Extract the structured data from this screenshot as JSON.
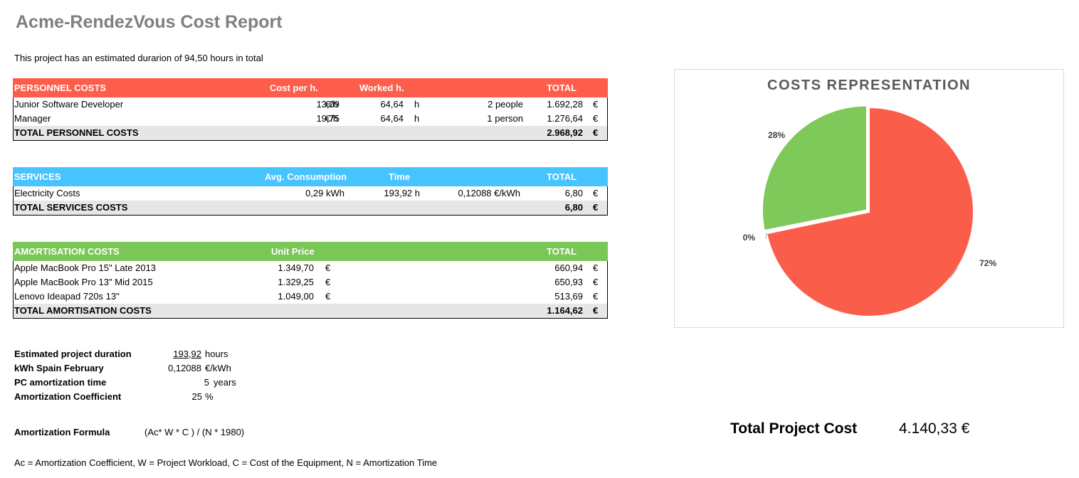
{
  "report": {
    "title": "Acme-RendezVous Cost Report",
    "intro": "This project has an estimated durarion of 94,50 hours in total"
  },
  "colors": {
    "personnel": "#ff5d4b",
    "services": "#47c3fe",
    "amortisation": "#7ac656",
    "total_bg": "#e7e6e6"
  },
  "personnel": {
    "header": {
      "name": "PERSONNEL COSTS",
      "cost": "Cost per h.",
      "worked": "Worked h.",
      "total": "TOTAL"
    },
    "rows": [
      {
        "name": "Junior Software Developer",
        "cost": "13,09",
        "cost_unit": "€/h",
        "hours": "64,64",
        "hours_unit": "h",
        "people": "2 people",
        "total": "1.692,28",
        "currency": "€"
      },
      {
        "name": "Manager",
        "cost": "19,75",
        "cost_unit": "€/h",
        "hours": "64,64",
        "hours_unit": "h",
        "people": "1 person",
        "total": "1.276,64",
        "currency": "€"
      }
    ],
    "total": {
      "label": "TOTAL PERSONNEL COSTS",
      "value": "2.968,92",
      "currency": "€"
    }
  },
  "services": {
    "header": {
      "name": "SERVICES",
      "consumption": "Avg. Consumption",
      "time": "Time",
      "total": "TOTAL"
    },
    "rows": [
      {
        "name": "Electricity Costs",
        "consumption": "0,29 kWh",
        "time": "193,92 h",
        "rate": "0,12088 €/kWh",
        "total": "6,80",
        "currency": "€"
      }
    ],
    "total": {
      "label": "TOTAL SERVICES COSTS",
      "value": "6,80",
      "currency": "€"
    }
  },
  "amortisation": {
    "header": {
      "name": "AMORTISATION COSTS",
      "unit_price": "Unit Price",
      "total": "TOTAL"
    },
    "rows": [
      {
        "name": "Apple MacBook Pro 15\" Late 2013",
        "price": "1.349,70",
        "price_currency": "€",
        "total": "660,94",
        "currency": "€"
      },
      {
        "name": "Apple MacBook Pro 13\" Mid 2015",
        "price": "1.329,25",
        "price_currency": "€",
        "total": "650,93",
        "currency": "€"
      },
      {
        "name": "Lenovo Ideapad  720s 13\"",
        "price": "1.049,00",
        "price_currency": "€",
        "total": "513,69",
        "currency": "€"
      }
    ],
    "total": {
      "label": "TOTAL AMORTISATION COSTS",
      "value": "1.164,62",
      "currency": "€"
    }
  },
  "params": [
    {
      "label": "Estimated project duration",
      "value": "193,92",
      "unit": "hours"
    },
    {
      "label": "kWh Spain February",
      "value": "0,12088",
      "unit": "€/kWh"
    },
    {
      "label": "PC amortization time",
      "value": "5",
      "unit": "years"
    },
    {
      "label": "Amortization Coefficient",
      "value": "25",
      "unit": "%"
    }
  ],
  "formula": {
    "label": "Amortization Formula",
    "value": "(Ac* W * C ) / (N * 1980)"
  },
  "legend_note": "Ac = Amortization Coefficient, W = Project Workload, C = Cost of the Equipment, N = Amortization Time",
  "grand_total": {
    "label": "Total Project Cost",
    "value": "4.140,33 €"
  },
  "chart_data": {
    "type": "pie",
    "title": "COSTS REPRESENTATION",
    "slices": [
      {
        "label": "72%",
        "value": 2968.92,
        "color": "#fb5d4b"
      },
      {
        "label": "0%",
        "value": 6.8,
        "color": "#47c3fe"
      },
      {
        "label": "28%",
        "value": 1164.62,
        "color": "#7ec959"
      }
    ],
    "data_labels": [
      "72%",
      "0%",
      "28%"
    ],
    "legend": "none"
  }
}
